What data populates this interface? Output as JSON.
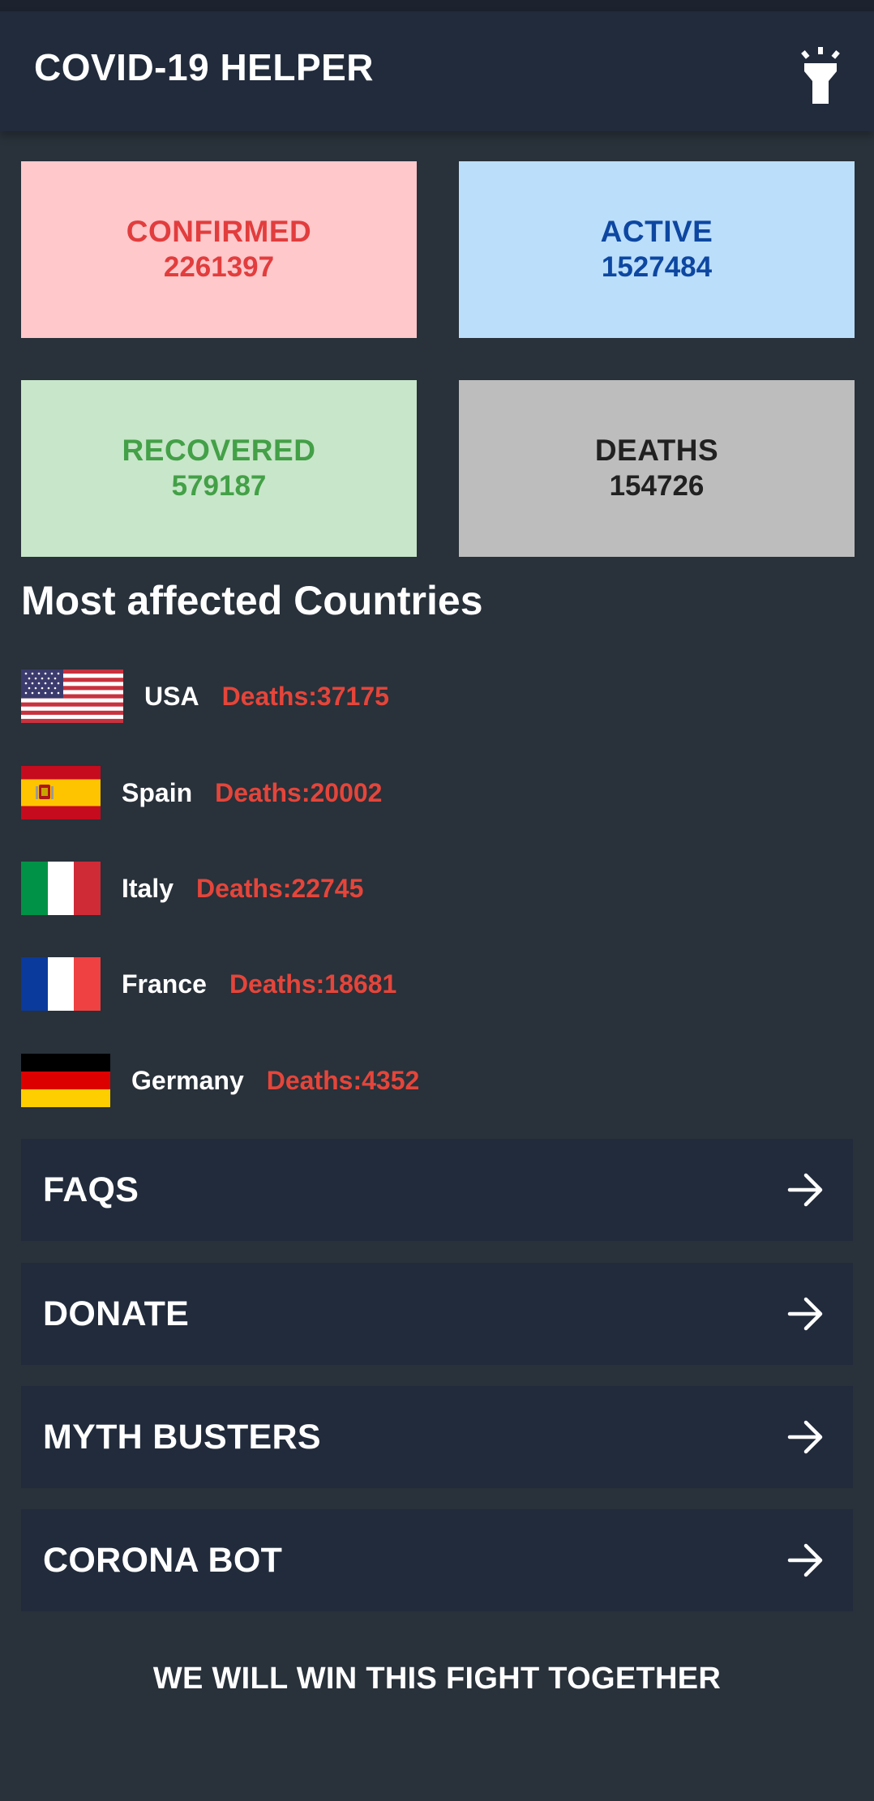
{
  "app_bar": {
    "title": "COVID-19 HELPER",
    "theme_icon": "flashlight-icon"
  },
  "stats": [
    {
      "label": "CONFIRMED",
      "value": "2261397",
      "bg": "#ffc8cb",
      "fg": "#e23d3d"
    },
    {
      "label": "ACTIVE",
      "value": "1527484",
      "bg": "#bbdefb",
      "fg": "#0d47a1"
    },
    {
      "label": "RECOVERED",
      "value": "579187",
      "bg": "#c8e6c9",
      "fg": "#43a047"
    },
    {
      "label": "DEATHS",
      "value": "154726",
      "bg": "#bdbdbd",
      "fg": "#212121"
    }
  ],
  "section_title": "Most affected Countries",
  "countries": [
    {
      "name": "USA",
      "deaths": "Deaths:37175",
      "flag": "usa-flag"
    },
    {
      "name": "Spain",
      "deaths": "Deaths:20002",
      "flag": "spain-flag"
    },
    {
      "name": "Italy",
      "deaths": "Deaths:22745",
      "flag": "italy-flag"
    },
    {
      "name": "France",
      "deaths": "Deaths:18681",
      "flag": "france-flag"
    },
    {
      "name": "Germany",
      "deaths": "Deaths:4352",
      "flag": "germany-flag"
    }
  ],
  "deaths_color": "#e5453a",
  "menu": [
    {
      "label": "FAQS",
      "icon": "arrow-right-icon"
    },
    {
      "label": "DONATE",
      "icon": "arrow-right-icon"
    },
    {
      "label": "MYTH BUSTERS",
      "icon": "arrow-right-icon"
    },
    {
      "label": "CORONA BOT",
      "icon": "arrow-right-icon"
    }
  ],
  "footer": "WE WILL WIN THIS FIGHT TOGETHER"
}
